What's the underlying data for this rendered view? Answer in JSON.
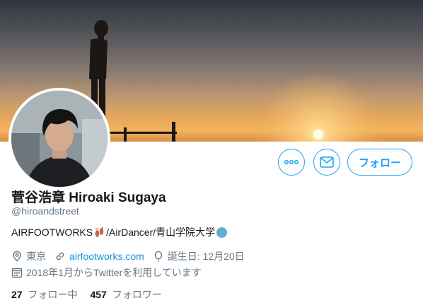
{
  "profile": {
    "name": "菅谷浩章 Hiroaki Sugaya",
    "handle": "@hiroandstreet",
    "bio_prefix": "AIRFOOTWORKS",
    "bio_suffix": "/AirDancer/青山学院大学",
    "bio_emojis": [
      "footprints-emoji",
      "globe-emoji"
    ]
  },
  "actions": {
    "more_icon": "more-dots-icon",
    "message_icon": "envelope-icon",
    "follow_label": "フォロー"
  },
  "meta": {
    "location": "東京",
    "website": "airfootworks.com",
    "birthday": "誕生日: 12月20日",
    "joined": "2018年1月からTwitterを利用しています"
  },
  "stats": {
    "following_count": "27",
    "following_label": "フォロー中",
    "followers_count": "457",
    "followers_label": "フォロワー"
  },
  "colors": {
    "accent": "#1da1f2",
    "link": "#1b95e0",
    "muted": "#657786",
    "text": "#14171a"
  }
}
